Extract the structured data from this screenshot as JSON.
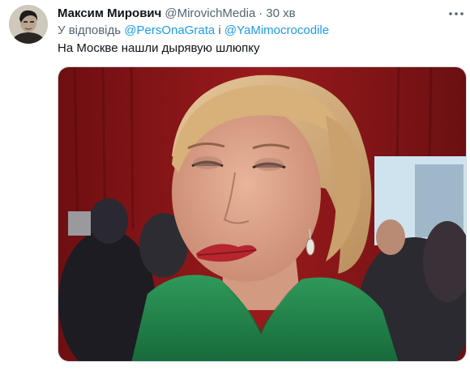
{
  "tweet": {
    "author": {
      "display_name": "Максим Мирович",
      "handle": "@MirovichMedia",
      "separator": "·",
      "time": "30 хв"
    },
    "reply": {
      "prefix": "У відповідь",
      "mention_1": "@PersOnaGrata",
      "conjunction": "і",
      "mention_2": "@YaMimocrocodile"
    },
    "text": "На Москве нашли дырявую шлюпку",
    "icons": {
      "more": "more-horizontal-icon",
      "avatar": "user-avatar"
    },
    "colors": {
      "link": "#1d9bf0",
      "secondary_text": "#536471",
      "primary_text": "#0f1419"
    }
  }
}
